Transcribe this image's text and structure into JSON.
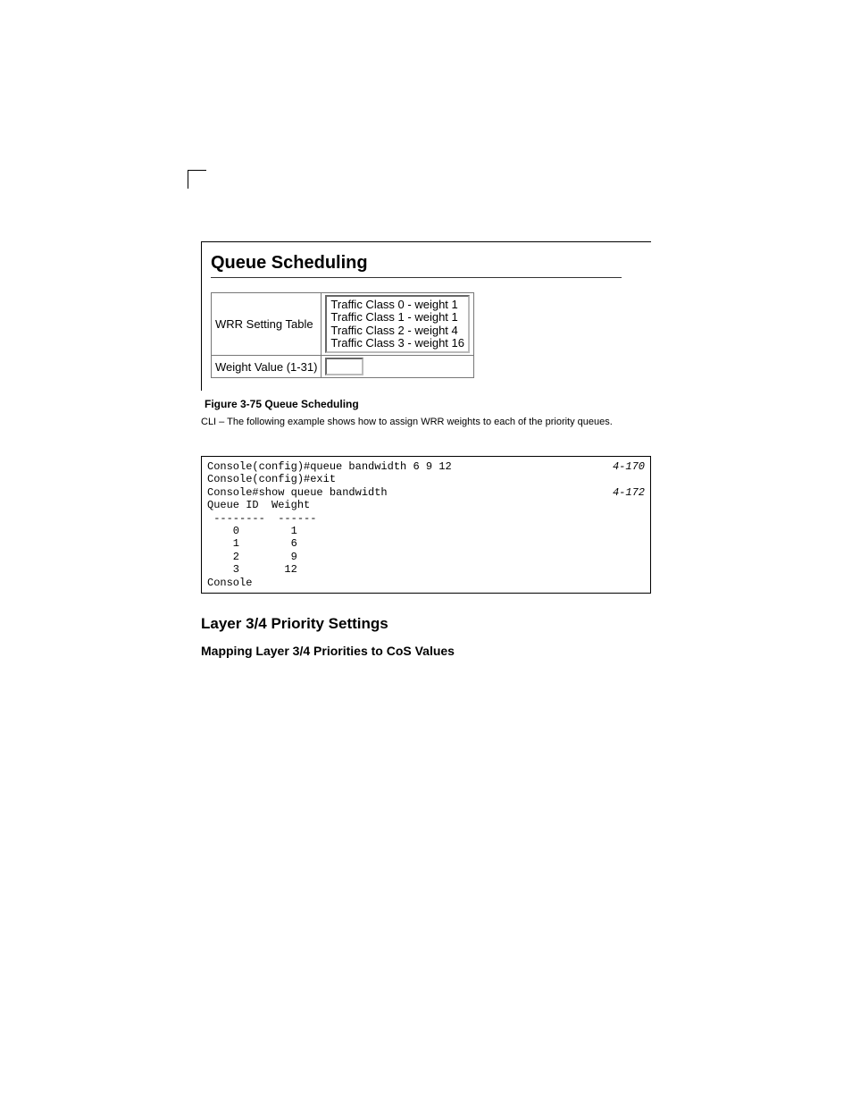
{
  "panel": {
    "title": "Queue Scheduling",
    "form": {
      "wrr_label": "WRR Setting Table",
      "wrr_items": [
        "Traffic Class 0 - weight 1",
        "Traffic Class 1 - weight 1",
        "Traffic Class 2 - weight 4",
        "Traffic Class 3 - weight 16"
      ],
      "weight_label": "Weight Value (1-31)",
      "weight_value": ""
    }
  },
  "figure_caption": "Figure 3-75  Queue Scheduling",
  "cli_intro": "CLI – The following example shows how to assign WRR weights to each of the priority queues.",
  "cli": {
    "ref1": "4-170",
    "ref2": "4-172",
    "line1": "Console(config)#queue bandwidth 6 9 12",
    "line2": "Console(config)#exit",
    "line3": "Console#show queue bandwidth",
    "line4": "Queue ID  Weight",
    "line5": " --------  ------",
    "line6": "    0        1",
    "line7": "    1        6",
    "line8": "    2        9",
    "line9": "    3       12",
    "line10": "Console"
  },
  "section": {
    "h2": "Layer 3/4 Priority Settings",
    "h3": "Mapping Layer 3/4 Priorities to CoS Values"
  }
}
